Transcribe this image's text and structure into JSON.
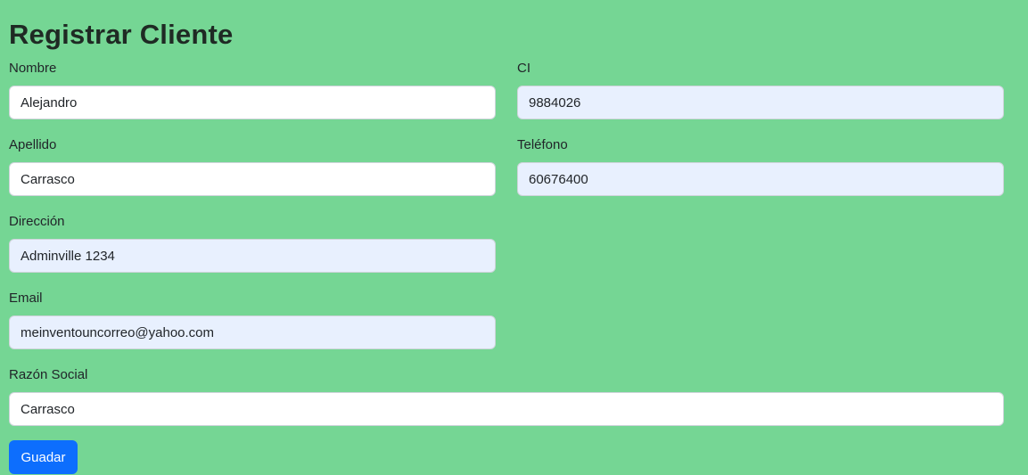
{
  "page": {
    "title": "Registrar Cliente"
  },
  "form": {
    "nombre": {
      "label": "Nombre",
      "value": "Alejandro"
    },
    "ci": {
      "label": "CI",
      "value": "9884026"
    },
    "apellido": {
      "label": "Apellido",
      "value": "Carrasco"
    },
    "telefono": {
      "label": "Teléfono",
      "value": "60676400"
    },
    "direccion": {
      "label": "Dirección",
      "value": "Adminville 1234"
    },
    "email": {
      "label": "Email",
      "value": "meinventouncorreo@yahoo.com"
    },
    "razon_social": {
      "label": "Razón Social",
      "value": "Carrasco"
    },
    "submit_label": "Guadar"
  },
  "colors": {
    "background": "#75d694",
    "primary": "#0d6efd",
    "autofill": "#e8f0fe"
  }
}
